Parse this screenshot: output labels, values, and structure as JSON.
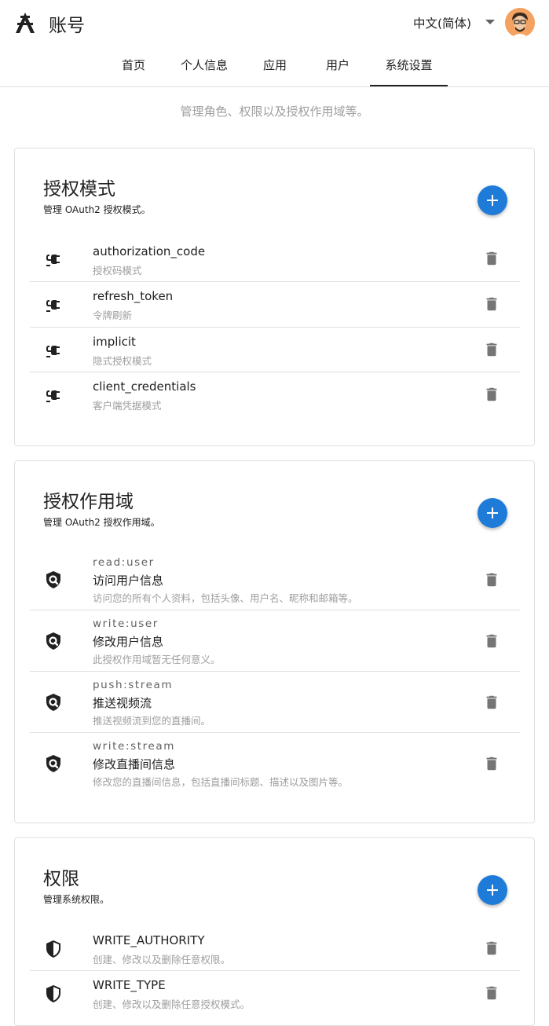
{
  "app": {
    "title": "账号",
    "language": "中文(简体)"
  },
  "tabs": [
    {
      "label": "首页"
    },
    {
      "label": "个人信息"
    },
    {
      "label": "应用"
    },
    {
      "label": "用户"
    },
    {
      "label": "系统设置",
      "active": true
    }
  ],
  "page_subtitle": "管理角色、权限以及授权作用域等。",
  "colors": {
    "accent": "#1e7bd8",
    "divider": "#e0e0e0",
    "secondary_text": "#9e9e9e",
    "icon_gray": "#757575"
  },
  "sections": {
    "grant_types": {
      "title": "授权模式",
      "subtitle": "管理 OAuth2 授权模式。",
      "icon": "power-plug-icon",
      "items": [
        {
          "title": "authorization_code",
          "desc": "授权码模式"
        },
        {
          "title": "refresh_token",
          "desc": "令牌刷新"
        },
        {
          "title": "implicit",
          "desc": "隐式授权模式"
        },
        {
          "title": "client_credentials",
          "desc": "客户端凭据模式"
        }
      ]
    },
    "scopes": {
      "title": "授权作用域",
      "subtitle": "管理 OAuth2 授权作用域。",
      "icon": "shield-search-icon",
      "items": [
        {
          "key": "read:user",
          "title": "访问用户信息",
          "desc": "访问您的所有个人资料，包括头像、用户名、昵称和邮箱等。"
        },
        {
          "key": "write:user",
          "title": "修改用户信息",
          "desc": "此授权作用域暂无任何意义。"
        },
        {
          "key": "push:stream",
          "title": "推送视频流",
          "desc": "推送视频流到您的直播间。"
        },
        {
          "key": "write:stream",
          "title": "修改直播间信息",
          "desc": "修改您的直播间信息，包括直播间标题、描述以及图片等。"
        }
      ]
    },
    "authorities": {
      "title": "权限",
      "subtitle": "管理系统权限。",
      "icon": "shield-half-icon",
      "items": [
        {
          "title": "WRITE_AUTHORITY",
          "desc": "创建、修改以及删除任意权限。"
        },
        {
          "title": "WRITE_TYPE",
          "desc": "创建、修改以及删除任意授权模式。"
        }
      ]
    }
  }
}
